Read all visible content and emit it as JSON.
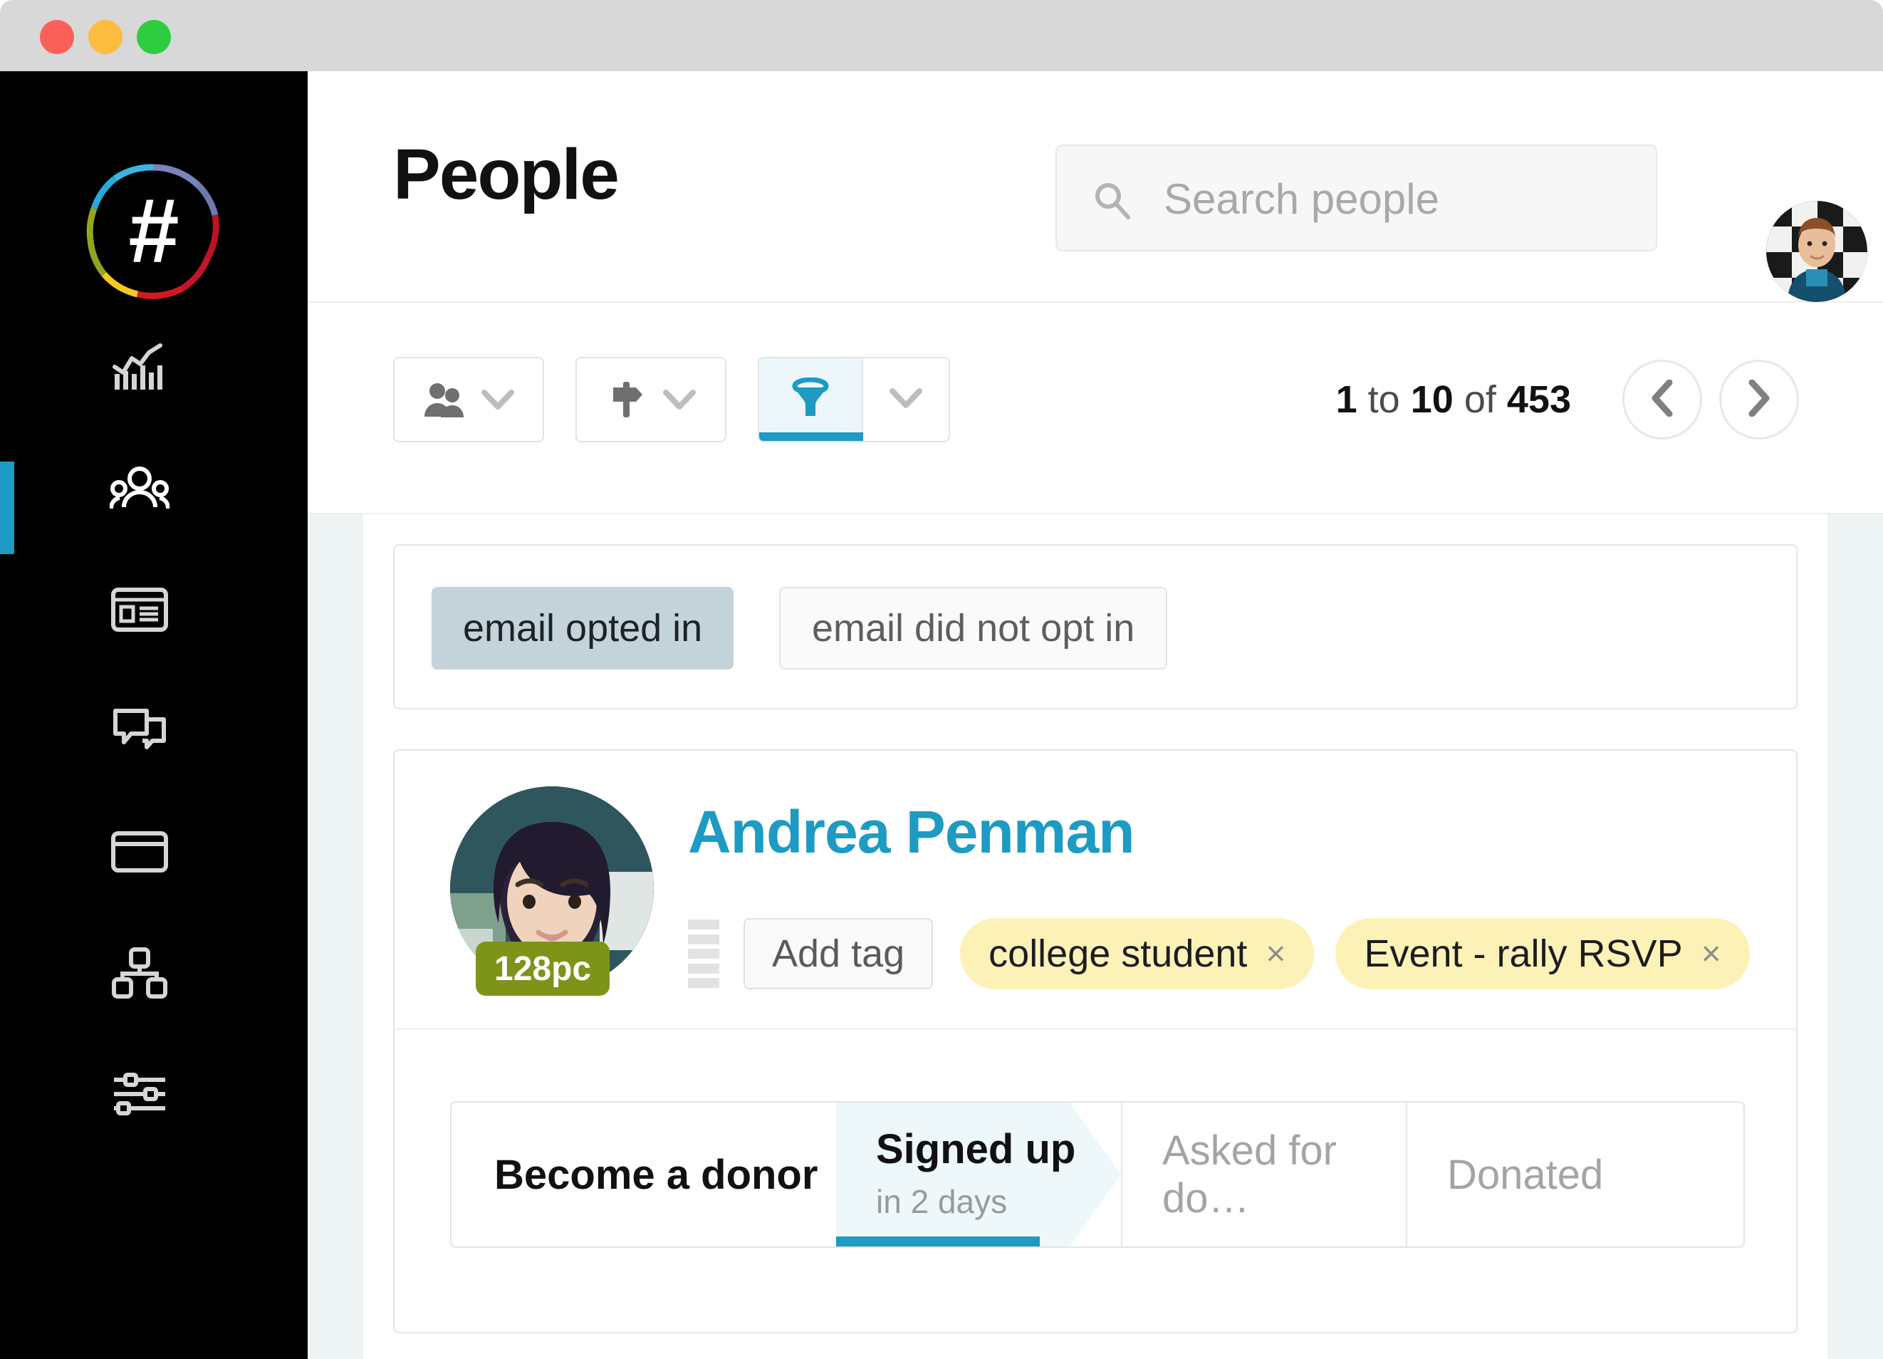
{
  "window": {
    "traffic_lights": [
      {
        "name": "close",
        "color": "#fb6058"
      },
      {
        "name": "minimize",
        "color": "#fcbc40"
      },
      {
        "name": "maximize",
        "color": "#2ecc40"
      }
    ]
  },
  "brand": {
    "logo_glyph": "#",
    "logo_name": "hashtag-ring-logo",
    "logo_colors": [
      "#2aa8d4",
      "#7b84b8",
      "#b5111b",
      "#c8132a",
      "#f5cc1a",
      "#8fa520",
      "#29a9d8"
    ]
  },
  "sidebar": {
    "active_color": "#1d9bc3",
    "items": [
      {
        "icon": "analytics-chart-icon",
        "label": "Analytics",
        "active": false
      },
      {
        "icon": "people-group-icon",
        "label": "People",
        "active": true
      },
      {
        "icon": "news-article-icon",
        "label": "Pages",
        "active": false
      },
      {
        "icon": "chat-bubbles-icon",
        "label": "Messages",
        "active": false
      },
      {
        "icon": "credit-card-icon",
        "label": "Payments",
        "active": false
      },
      {
        "icon": "org-chart-icon",
        "label": "Structure",
        "active": false
      },
      {
        "icon": "sliders-settings-icon",
        "label": "Settings",
        "active": false
      }
    ]
  },
  "header": {
    "title": "People",
    "search": {
      "placeholder": "Search people",
      "value": "",
      "icon": "search-icon"
    },
    "user_avatar": "user-avatar-photo"
  },
  "toolbar": {
    "buttons": [
      {
        "name": "people-filter",
        "icon": "people-icon",
        "chevron": "chevron-down-icon",
        "active": false
      },
      {
        "name": "signpost-filter",
        "icon": "signpost-icon",
        "chevron": "chevron-down-icon",
        "active": false
      },
      {
        "name": "funnel-filter",
        "icon": "funnel-icon",
        "chevron": "chevron-down-icon",
        "active": true
      }
    ],
    "pagination": {
      "range_start": "1",
      "range_mid_label": "to",
      "range_end": "10",
      "of_label": "of",
      "total": "453",
      "prev_icon": "chevron-left-icon",
      "next_icon": "chevron-right-icon"
    }
  },
  "filters": {
    "options": [
      {
        "label": "email opted in",
        "selected": true
      },
      {
        "label": "email did not opt in",
        "selected": false
      }
    ]
  },
  "person": {
    "name": "Andrea Penman",
    "name_color": "#1d9bc3",
    "avatar": "person-avatar-photo",
    "badge": "128pc",
    "badge_color": "#7d9419",
    "drag_handle": "drag-handle-icon",
    "add_tag_label": "Add tag",
    "tags": [
      {
        "label": "college student",
        "remove": "×"
      },
      {
        "label": "Event - rally RSVP",
        "remove": "×"
      }
    ],
    "pipeline": {
      "label": "Become a donor",
      "stages": [
        {
          "title": "Signed up",
          "subtitle": "in 2 days",
          "active": true
        },
        {
          "title": "Asked for do…",
          "subtitle": "",
          "active": false
        },
        {
          "title": "Donated",
          "subtitle": "",
          "active": false
        }
      ]
    }
  }
}
